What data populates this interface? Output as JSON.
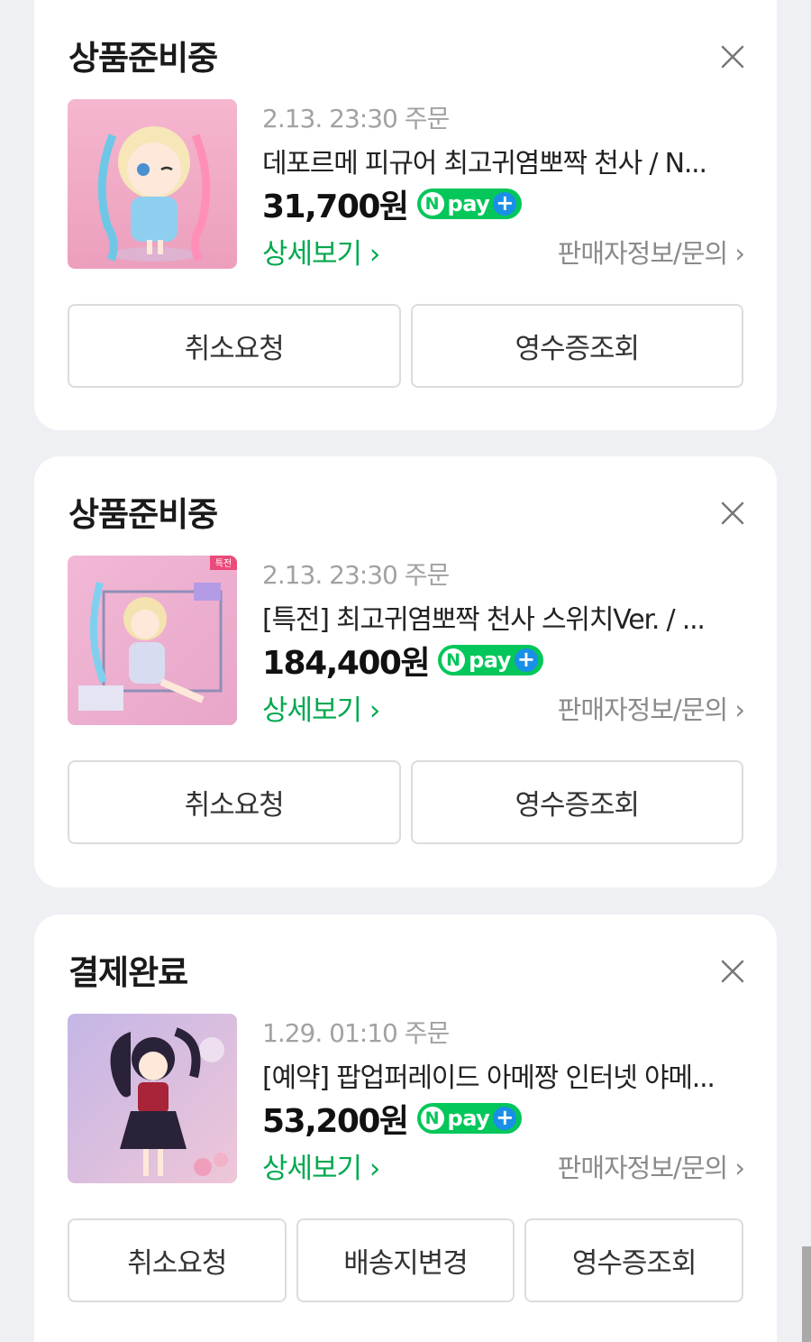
{
  "orders": [
    {
      "status": "상품준비중",
      "date": "2.13. 23:30 주문",
      "product": "데포르메 피규어 최고귀염뽀짝 천사 / N...",
      "price": "31,700원",
      "detail_label": "상세보기 ›",
      "seller_label": "판매자정보/문의 ›",
      "buttons": [
        "취소요청",
        "영수증조회"
      ]
    },
    {
      "status": "상품준비중",
      "date": "2.13. 23:30 주문",
      "product": "[특전] 최고귀염뽀짝 천사 스위치Ver. / ...",
      "price": "184,400원",
      "detail_label": "상세보기 ›",
      "seller_label": "판매자정보/문의 ›",
      "thumb_badge": "특전",
      "buttons": [
        "취소요청",
        "영수증조회"
      ]
    },
    {
      "status": "결제완료",
      "date": "1.29. 01:10 주문",
      "product": "[예약] 팝업퍼레이드 아메짱 인터넷 야메...",
      "price": "53,200원",
      "detail_label": "상세보기 ›",
      "seller_label": "판매자정보/문의 ›",
      "buttons": [
        "취소요청",
        "배송지변경",
        "영수증조회"
      ]
    }
  ],
  "npay": {
    "n": "N",
    "text": "pay",
    "plus": "+"
  },
  "colors": {
    "accent_green": "#03c75a",
    "link_green": "#03a94f",
    "background": "#eef0f3"
  },
  "icons": {
    "close": "close-icon",
    "chevron": "chevron-right-icon"
  }
}
